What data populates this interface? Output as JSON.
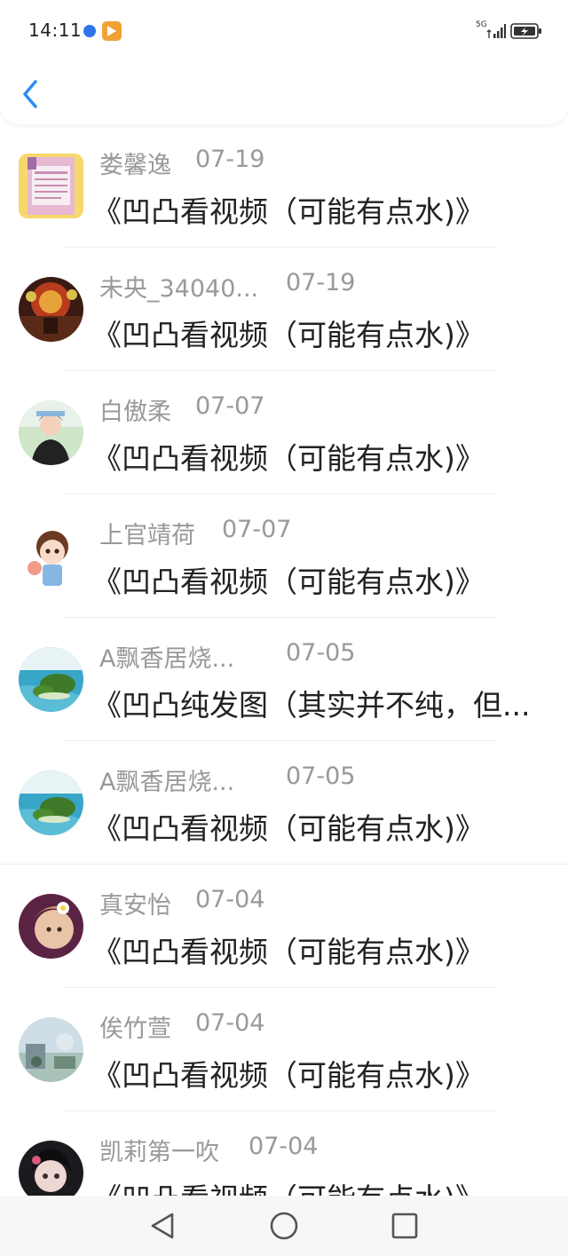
{
  "status": {
    "time": "14:11",
    "network": "5G",
    "colors": {
      "notification_blue": "#2f74e8",
      "notification_orange": "#f2a233"
    }
  },
  "header": {
    "back_icon": "chevron-left-icon",
    "accent": "#2d8cf0"
  },
  "items": [
    {
      "name": "娄馨逸",
      "date": "07-19",
      "title": "《凹凸看视频（可能有点水)》"
    },
    {
      "name": "未央_34040...",
      "date": "07-19",
      "title": "《凹凸看视频（可能有点水)》"
    },
    {
      "name": "白傲柔",
      "date": "07-07",
      "title": "《凹凸看视频（可能有点水)》"
    },
    {
      "name": "上官靖荷",
      "date": "07-07",
      "title": "《凹凸看视频（可能有点水)》"
    },
    {
      "name": "A飘香居烧...",
      "date": "07-05",
      "title": "《凹凸纯发图（其实并不纯，但..."
    },
    {
      "name": "A飘香居烧...",
      "date": "07-05",
      "title": "《凹凸看视频（可能有点水)》"
    },
    {
      "name": "真安怡",
      "date": "07-04",
      "title": "《凹凸看视频（可能有点水)》"
    },
    {
      "name": "俟竹萱",
      "date": "07-04",
      "title": "《凹凸看视频（可能有点水)》"
    },
    {
      "name": "凯莉第一吹",
      "date": "07-04",
      "title": "《凹凸看视频（可能有点水)》"
    }
  ],
  "nav": {
    "back": "triangle-back-icon",
    "home": "circle-home-icon",
    "recents": "square-recents-icon"
  }
}
